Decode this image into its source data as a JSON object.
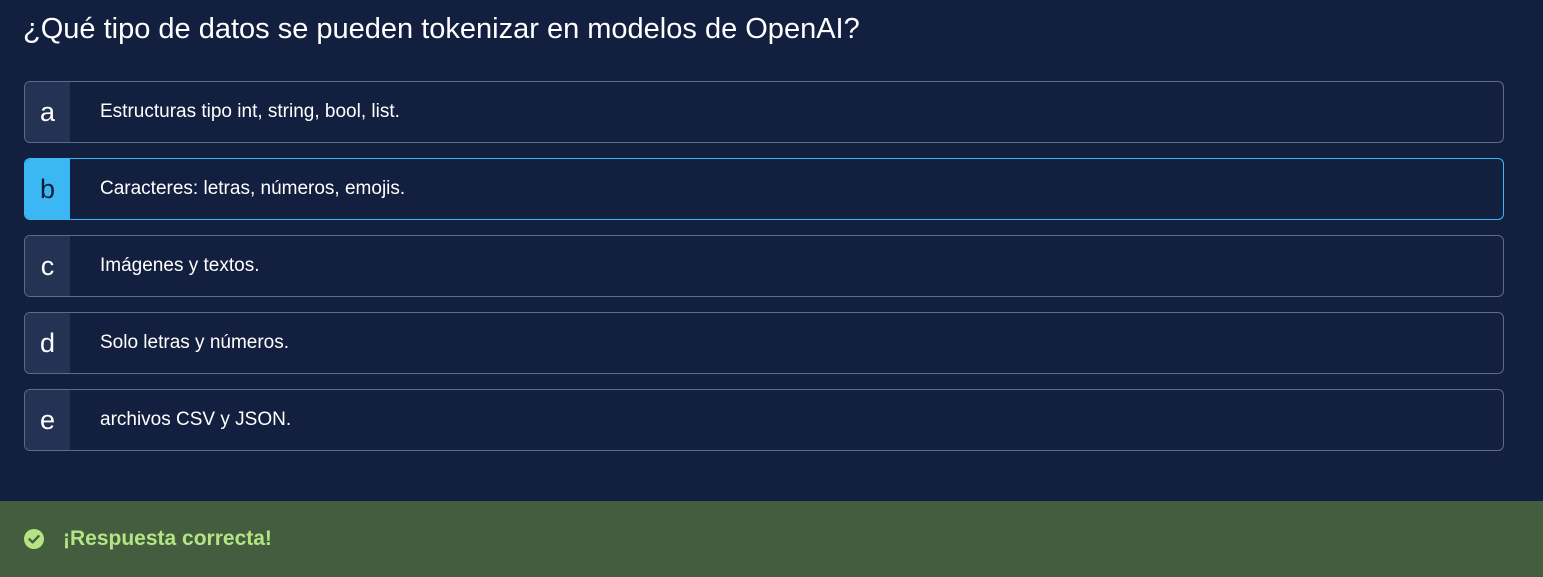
{
  "question": {
    "text": "¿Qué tipo de datos se pueden tokenizar en modelos de OpenAI?"
  },
  "options": [
    {
      "letter": "a",
      "text": "Estructuras tipo int, string, bool, list."
    },
    {
      "letter": "b",
      "text": "Caracteres: letras, números, emojis."
    },
    {
      "letter": "c",
      "text": "Imágenes y textos."
    },
    {
      "letter": "d",
      "text": "Solo letras y números."
    },
    {
      "letter": "e",
      "text": "archivos CSV y JSON."
    }
  ],
  "selected_option": "b",
  "feedback": {
    "icon": "check-circle-icon",
    "message": "¡Respuesta correcta!"
  },
  "colors": {
    "background": "#131f3e",
    "accent": "#3bb7f3",
    "success_bg": "#435d3e",
    "success_text": "#b4e484"
  }
}
